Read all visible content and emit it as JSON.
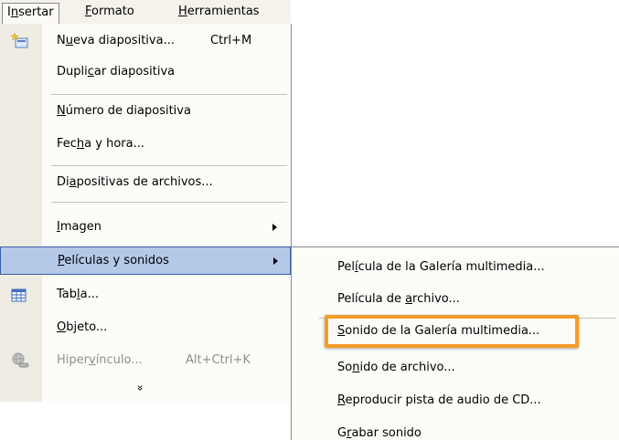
{
  "menubar": {
    "items": [
      {
        "pre": "I",
        "u": "n",
        "post": "sertar"
      },
      {
        "pre": "",
        "u": "F",
        "post": "ormato"
      },
      {
        "pre": "",
        "u": "H",
        "post": "erramientas"
      }
    ]
  },
  "insert_menu": {
    "items": [
      {
        "pre": "N",
        "u": "u",
        "post": "eva diapositiva...",
        "shortcut": "Ctrl+M"
      },
      {
        "pre": "Dupli",
        "u": "c",
        "post": "ar diapositiva"
      },
      {
        "pre": "",
        "u": "N",
        "post": "úmero de diapositiva"
      },
      {
        "pre": "Fec",
        "u": "h",
        "post": "a y hora..."
      },
      {
        "pre": "Di",
        "u": "a",
        "post": "positivas de archivos..."
      },
      {
        "pre": "",
        "u": "I",
        "post": "magen"
      },
      {
        "pre": "",
        "u": "P",
        "post": "elículas y sonidos"
      },
      {
        "pre": "Tab",
        "u": "l",
        "post": "a..."
      },
      {
        "pre": "",
        "u": "O",
        "post": "bjeto..."
      },
      {
        "pre": "Hiper",
        "u": "v",
        "post": "ínculo...",
        "shortcut": "Alt+Ctrl+K"
      }
    ],
    "expand_glyph": "»"
  },
  "movies_submenu": {
    "items": [
      {
        "pre": "Pel",
        "u": "í",
        "post": "cula de la Galería multimedia..."
      },
      {
        "pre": "Película de ",
        "u": "a",
        "post": "rchivo..."
      },
      {
        "pre": "",
        "u": "S",
        "post": "onido de la Galería multimedia..."
      },
      {
        "pre": "So",
        "u": "n",
        "post": "ido de archivo..."
      },
      {
        "pre": "",
        "u": "R",
        "post": "eproducir pista de audio de CD..."
      },
      {
        "pre": "G",
        "u": "r",
        "post": "abar sonido"
      }
    ]
  },
  "icons": {
    "new_slide": "new-slide-icon",
    "table": "table-icon",
    "hyperlink": "hyperlink-icon"
  },
  "colors": {
    "highlight_fill": "#b4c8e8",
    "highlight_border": "#3b5fa9",
    "annotation_border": "#f39c28"
  }
}
